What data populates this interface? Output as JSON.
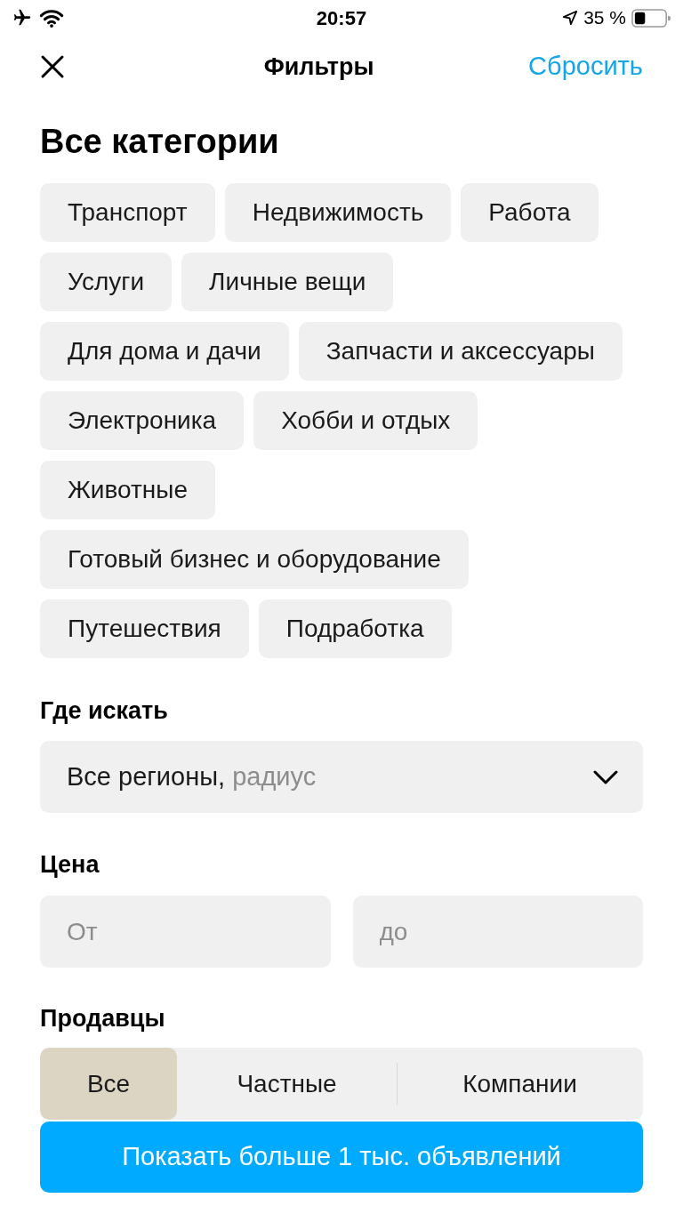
{
  "status_bar": {
    "time": "20:57",
    "battery": "35 %"
  },
  "header": {
    "title": "Фильтры",
    "reset": "Сбросить"
  },
  "categories": {
    "title": "Все категории",
    "chips": [
      "Транспорт",
      "Недвижимость",
      "Работа",
      "Услуги",
      "Личные вещи",
      "Для дома и дачи",
      "Запчасти и аксессуары",
      "Электроника",
      "Хобби и отдых",
      "Животные",
      "Готовый бизнес и оборудование",
      "Путешествия",
      "Подработка"
    ]
  },
  "location": {
    "label": "Где искать",
    "value": "Все регионы,",
    "hint": "радиус"
  },
  "price": {
    "label": "Цена",
    "from": {
      "placeholder": "От"
    },
    "to": {
      "placeholder": "до"
    }
  },
  "sellers": {
    "label": "Продавцы",
    "options": [
      {
        "label": "Все",
        "selected": true
      },
      {
        "label": "Частные",
        "selected": false
      },
      {
        "label": "Компании",
        "selected": false
      }
    ]
  },
  "show_button": "Показать больше 1 тыс. объявлений"
}
